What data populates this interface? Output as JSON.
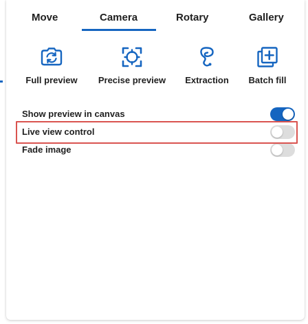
{
  "tabs": [
    {
      "label": "Move",
      "active": false
    },
    {
      "label": "Camera",
      "active": true
    },
    {
      "label": "Rotary",
      "active": false
    },
    {
      "label": "Gallery",
      "active": false
    }
  ],
  "tools": [
    {
      "label": "Full preview",
      "icon": "full-preview-icon"
    },
    {
      "label": "Precise preview",
      "icon": "precise-preview-icon"
    },
    {
      "label": "Extraction",
      "icon": "extraction-icon"
    },
    {
      "label": "Batch fill",
      "icon": "batch-fill-icon"
    }
  ],
  "settings": [
    {
      "label": "Show preview in canvas",
      "enabled": true
    },
    {
      "label": "Live view control",
      "enabled": false,
      "highlighted": true
    },
    {
      "label": "Fade image",
      "enabled": false
    }
  ],
  "colors": {
    "accent": "#1565c0",
    "highlight_border": "#d9534f",
    "toggle_off": "#dddddd"
  }
}
